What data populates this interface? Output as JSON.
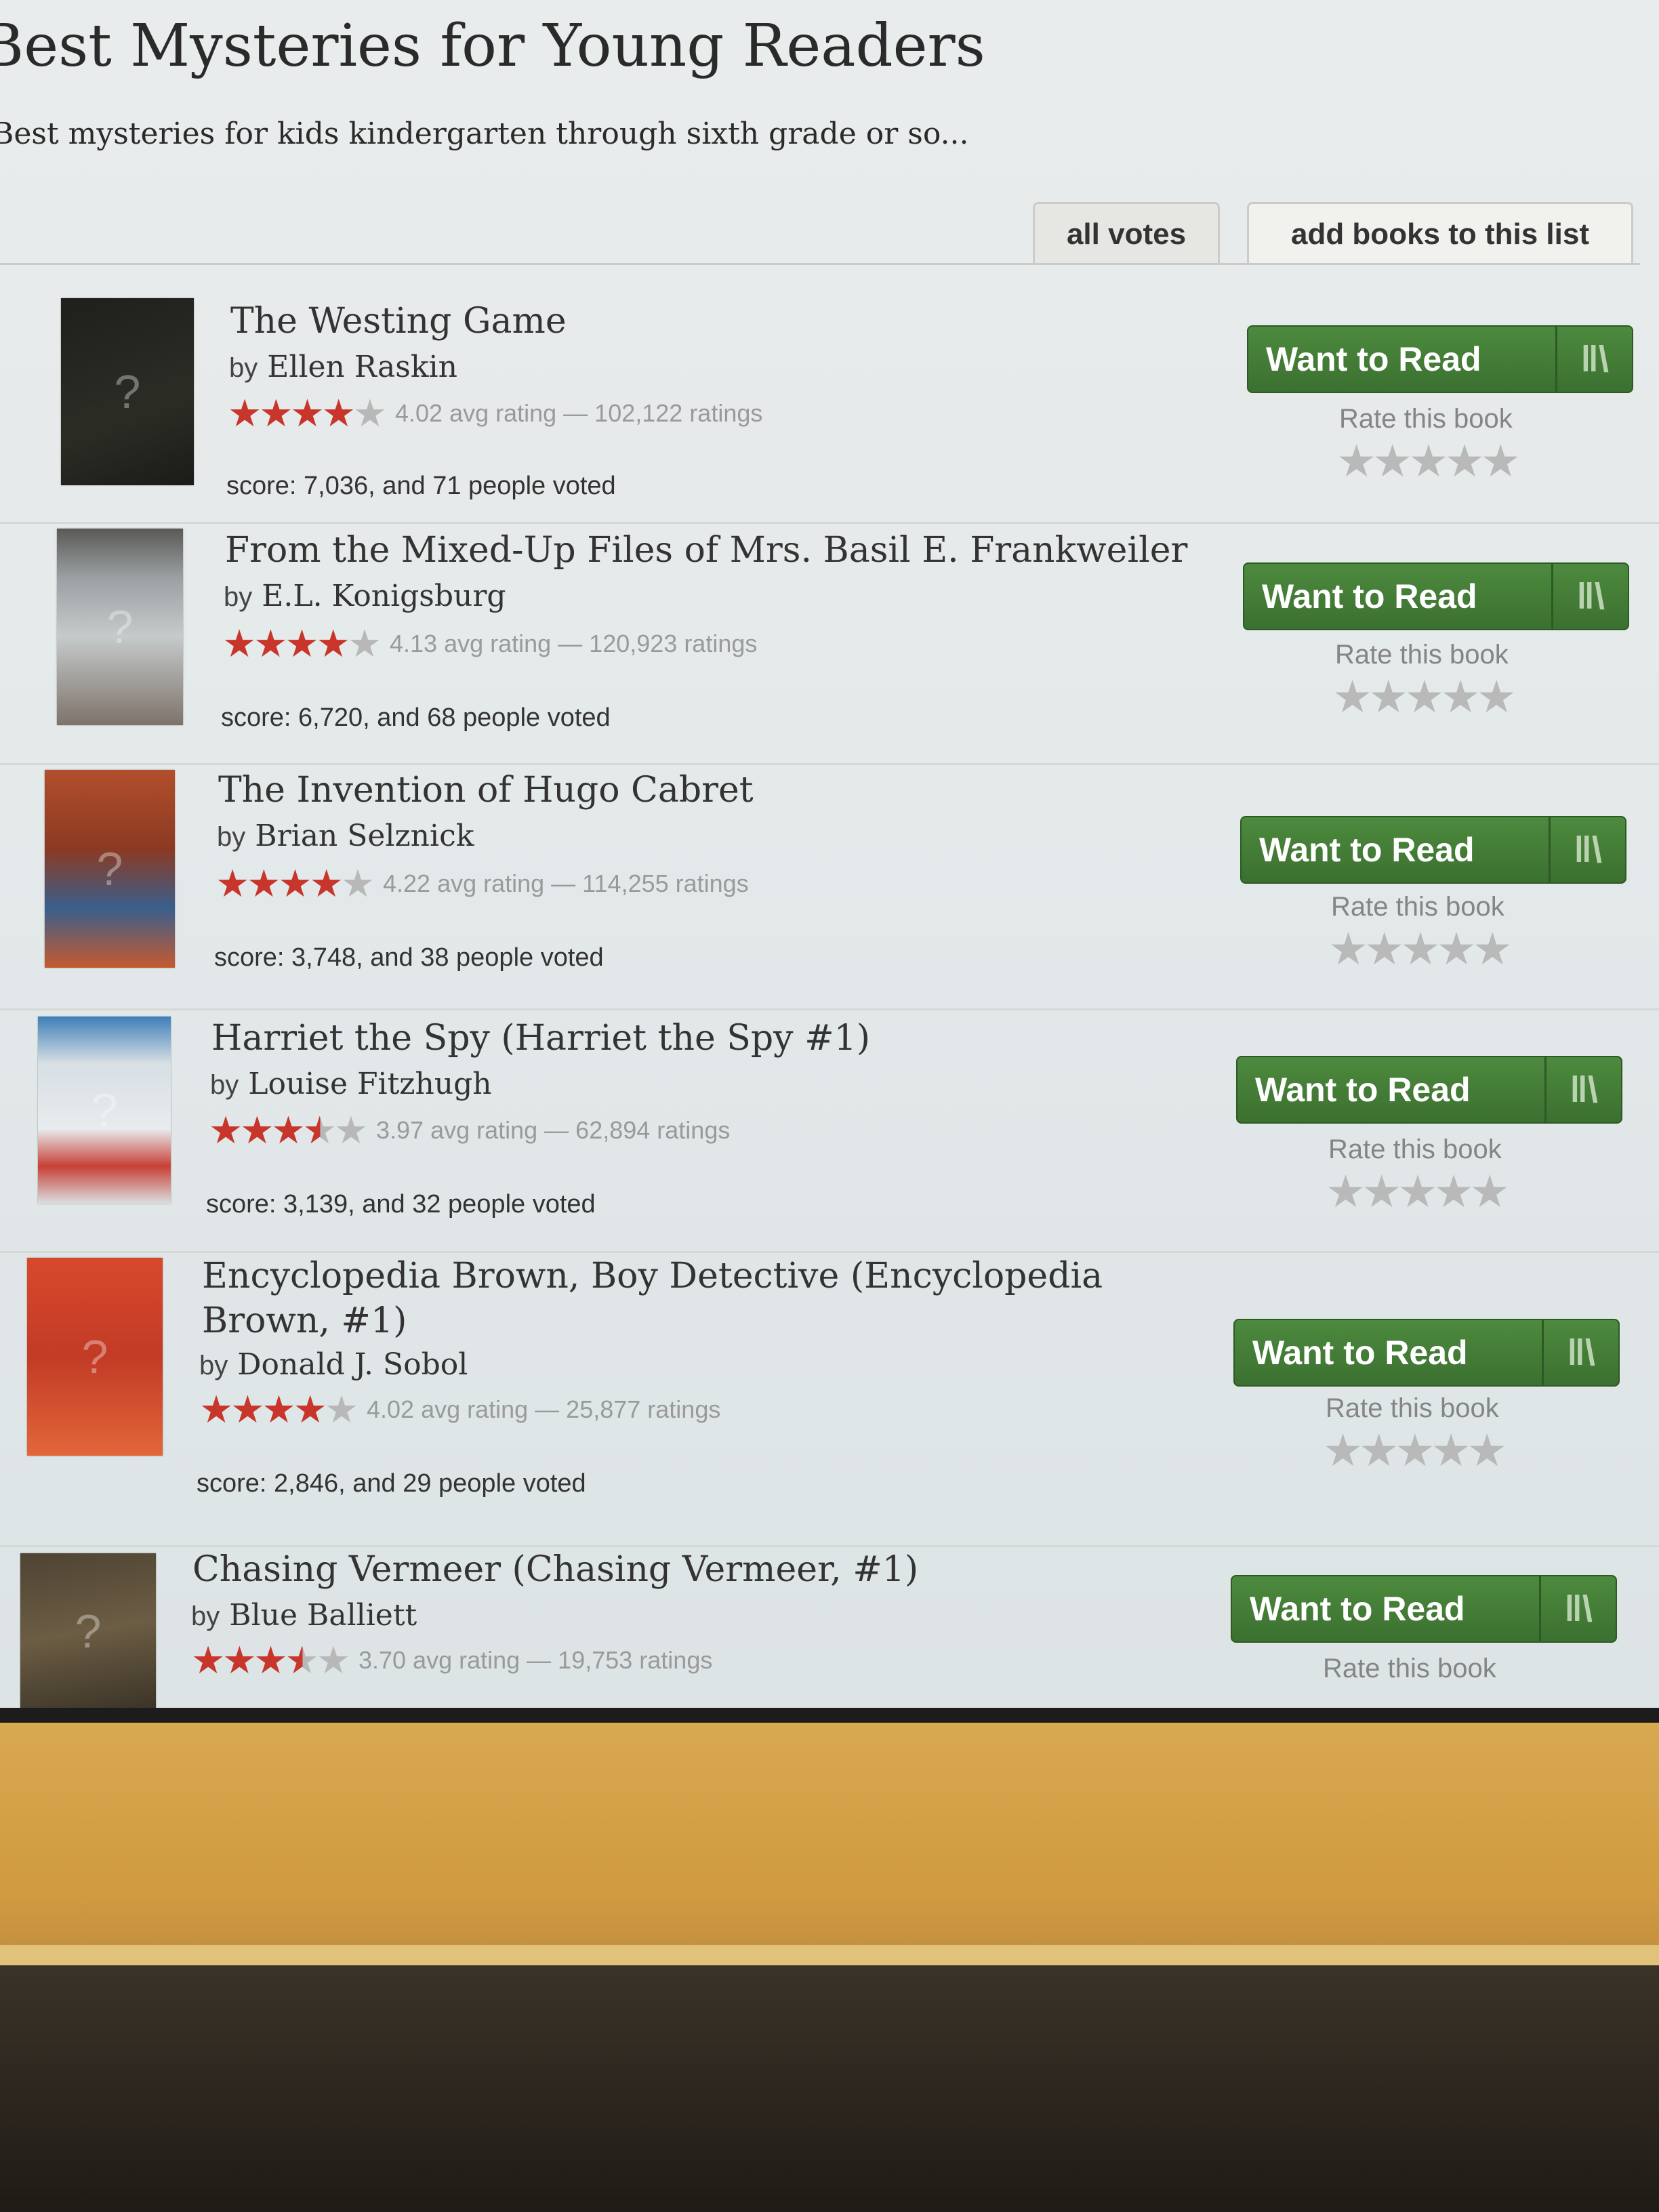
{
  "page": {
    "title": "Best Mysteries for Young Readers",
    "description": "Best mysteries for kids kindergarten through sixth grade or so..."
  },
  "tabs": [
    {
      "label": "all votes",
      "active": true
    },
    {
      "label": "add books to this list",
      "active": false
    }
  ],
  "labels": {
    "want_to_read": "Want to Read",
    "rate_this_book": "Rate this book",
    "by": "by"
  },
  "colors": {
    "want_to_read_green": "#3f7a33",
    "rating_star_red": "#c7352b"
  },
  "books": [
    {
      "title": "The Westing Game",
      "author": "Ellen Raskin",
      "avg_rating": 4.02,
      "rating_text": "4.02 avg rating — 102,122 ratings",
      "score_line": "score: 7,036, and 71 people voted"
    },
    {
      "title": "From the Mixed-Up Files of Mrs. Basil E. Frankweiler",
      "author": "E.L. Konigsburg",
      "avg_rating": 4.13,
      "rating_text": "4.13 avg rating — 120,923 ratings",
      "score_line": "score: 6,720, and 68 people voted"
    },
    {
      "title": "The Invention of Hugo Cabret",
      "author": "Brian Selznick",
      "avg_rating": 4.22,
      "rating_text": "4.22 avg rating — 114,255 ratings",
      "score_line": "score: 3,748, and 38 people voted"
    },
    {
      "title": "Harriet the Spy (Harriet the Spy #1)",
      "author": "Louise Fitzhugh",
      "avg_rating": 3.97,
      "rating_text": "3.97 avg rating — 62,894 ratings",
      "score_line": "score: 3,139, and 32 people voted"
    },
    {
      "title": "Encyclopedia Brown, Boy Detective (Encyclopedia Brown, #1)",
      "author": "Donald J. Sobol",
      "avg_rating": 4.02,
      "rating_text": "4.02 avg rating — 25,877 ratings",
      "score_line": "score: 2,846, and 29 people voted"
    },
    {
      "title": "Chasing Vermeer (Chasing Vermeer, #1)",
      "author": "Blue Balliett",
      "avg_rating": 3.7,
      "rating_text": "3.70 avg rating — 19,753 ratings",
      "score_line": ""
    }
  ]
}
